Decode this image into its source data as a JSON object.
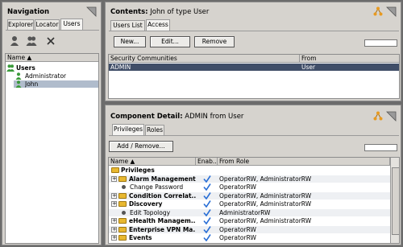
{
  "navigation": {
    "title": "Navigation",
    "tabs": [
      "Explorer",
      "Locator",
      "Users"
    ],
    "active_tab": "Users",
    "toolbar_icons": [
      "user-icon",
      "users-icon",
      "delete-icon"
    ],
    "tree_header": "Name",
    "tree": {
      "root_label": "Users",
      "children": [
        "Administrator",
        "John"
      ],
      "selected": "John"
    }
  },
  "contents": {
    "title_bold": "Contents:",
    "title_rest": " John of type User",
    "tabs": [
      "Users List",
      "Access"
    ],
    "active_tab": "Access",
    "buttons": {
      "new": "New...",
      "edit": "Edit...",
      "remove": "Remove"
    },
    "columns": [
      "Security Communities",
      "From"
    ],
    "rows": [
      {
        "community": "ADMIN",
        "from": "User"
      }
    ]
  },
  "detail": {
    "title_bold": "Component Detail:",
    "title_rest": " ADMIN from User",
    "tabs": [
      "Privileges",
      "Roles"
    ],
    "active_tab": "Privileges",
    "add_remove_label": "Add / Remove...",
    "columns": [
      "Name",
      "Enab...",
      "From Role"
    ],
    "rows": [
      {
        "name": "Privileges",
        "bold": true,
        "expander": "",
        "icon": "folder",
        "enabled": false,
        "from": ""
      },
      {
        "name": "Alarm Management",
        "bold": true,
        "expander": "+",
        "icon": "folder",
        "enabled": true,
        "from": "OperatorRW, AdministratorRW"
      },
      {
        "name": "Change Password",
        "bold": false,
        "expander": "",
        "icon": "dot",
        "enabled": true,
        "from": "OperatorRW"
      },
      {
        "name": "Condition Correlat...",
        "bold": true,
        "expander": "+",
        "icon": "folder",
        "enabled": true,
        "from": "OperatorRW, AdministratorRW"
      },
      {
        "name": "Discovery",
        "bold": true,
        "expander": "+",
        "icon": "folder",
        "enabled": true,
        "from": "OperatorRW, AdministratorRW"
      },
      {
        "name": "Edit Topology",
        "bold": false,
        "expander": "",
        "icon": "dot",
        "enabled": true,
        "from": "AdministratorRW"
      },
      {
        "name": "eHealth Managem...",
        "bold": true,
        "expander": "+",
        "icon": "folder",
        "enabled": true,
        "from": "OperatorRW, AdministratorRW"
      },
      {
        "name": "Enterprise VPN Ma...",
        "bold": true,
        "expander": "+",
        "icon": "folder",
        "enabled": true,
        "from": "OperatorRW"
      },
      {
        "name": "Events",
        "bold": true,
        "expander": "+",
        "icon": "folder",
        "enabled": true,
        "from": "OperatorRW"
      }
    ]
  },
  "colors": {
    "selection": "#404e68",
    "panel": "#d6d3ce",
    "check": "#2a6fd6",
    "folder": "#e8b830",
    "user_icon": "#3a9a3a"
  }
}
